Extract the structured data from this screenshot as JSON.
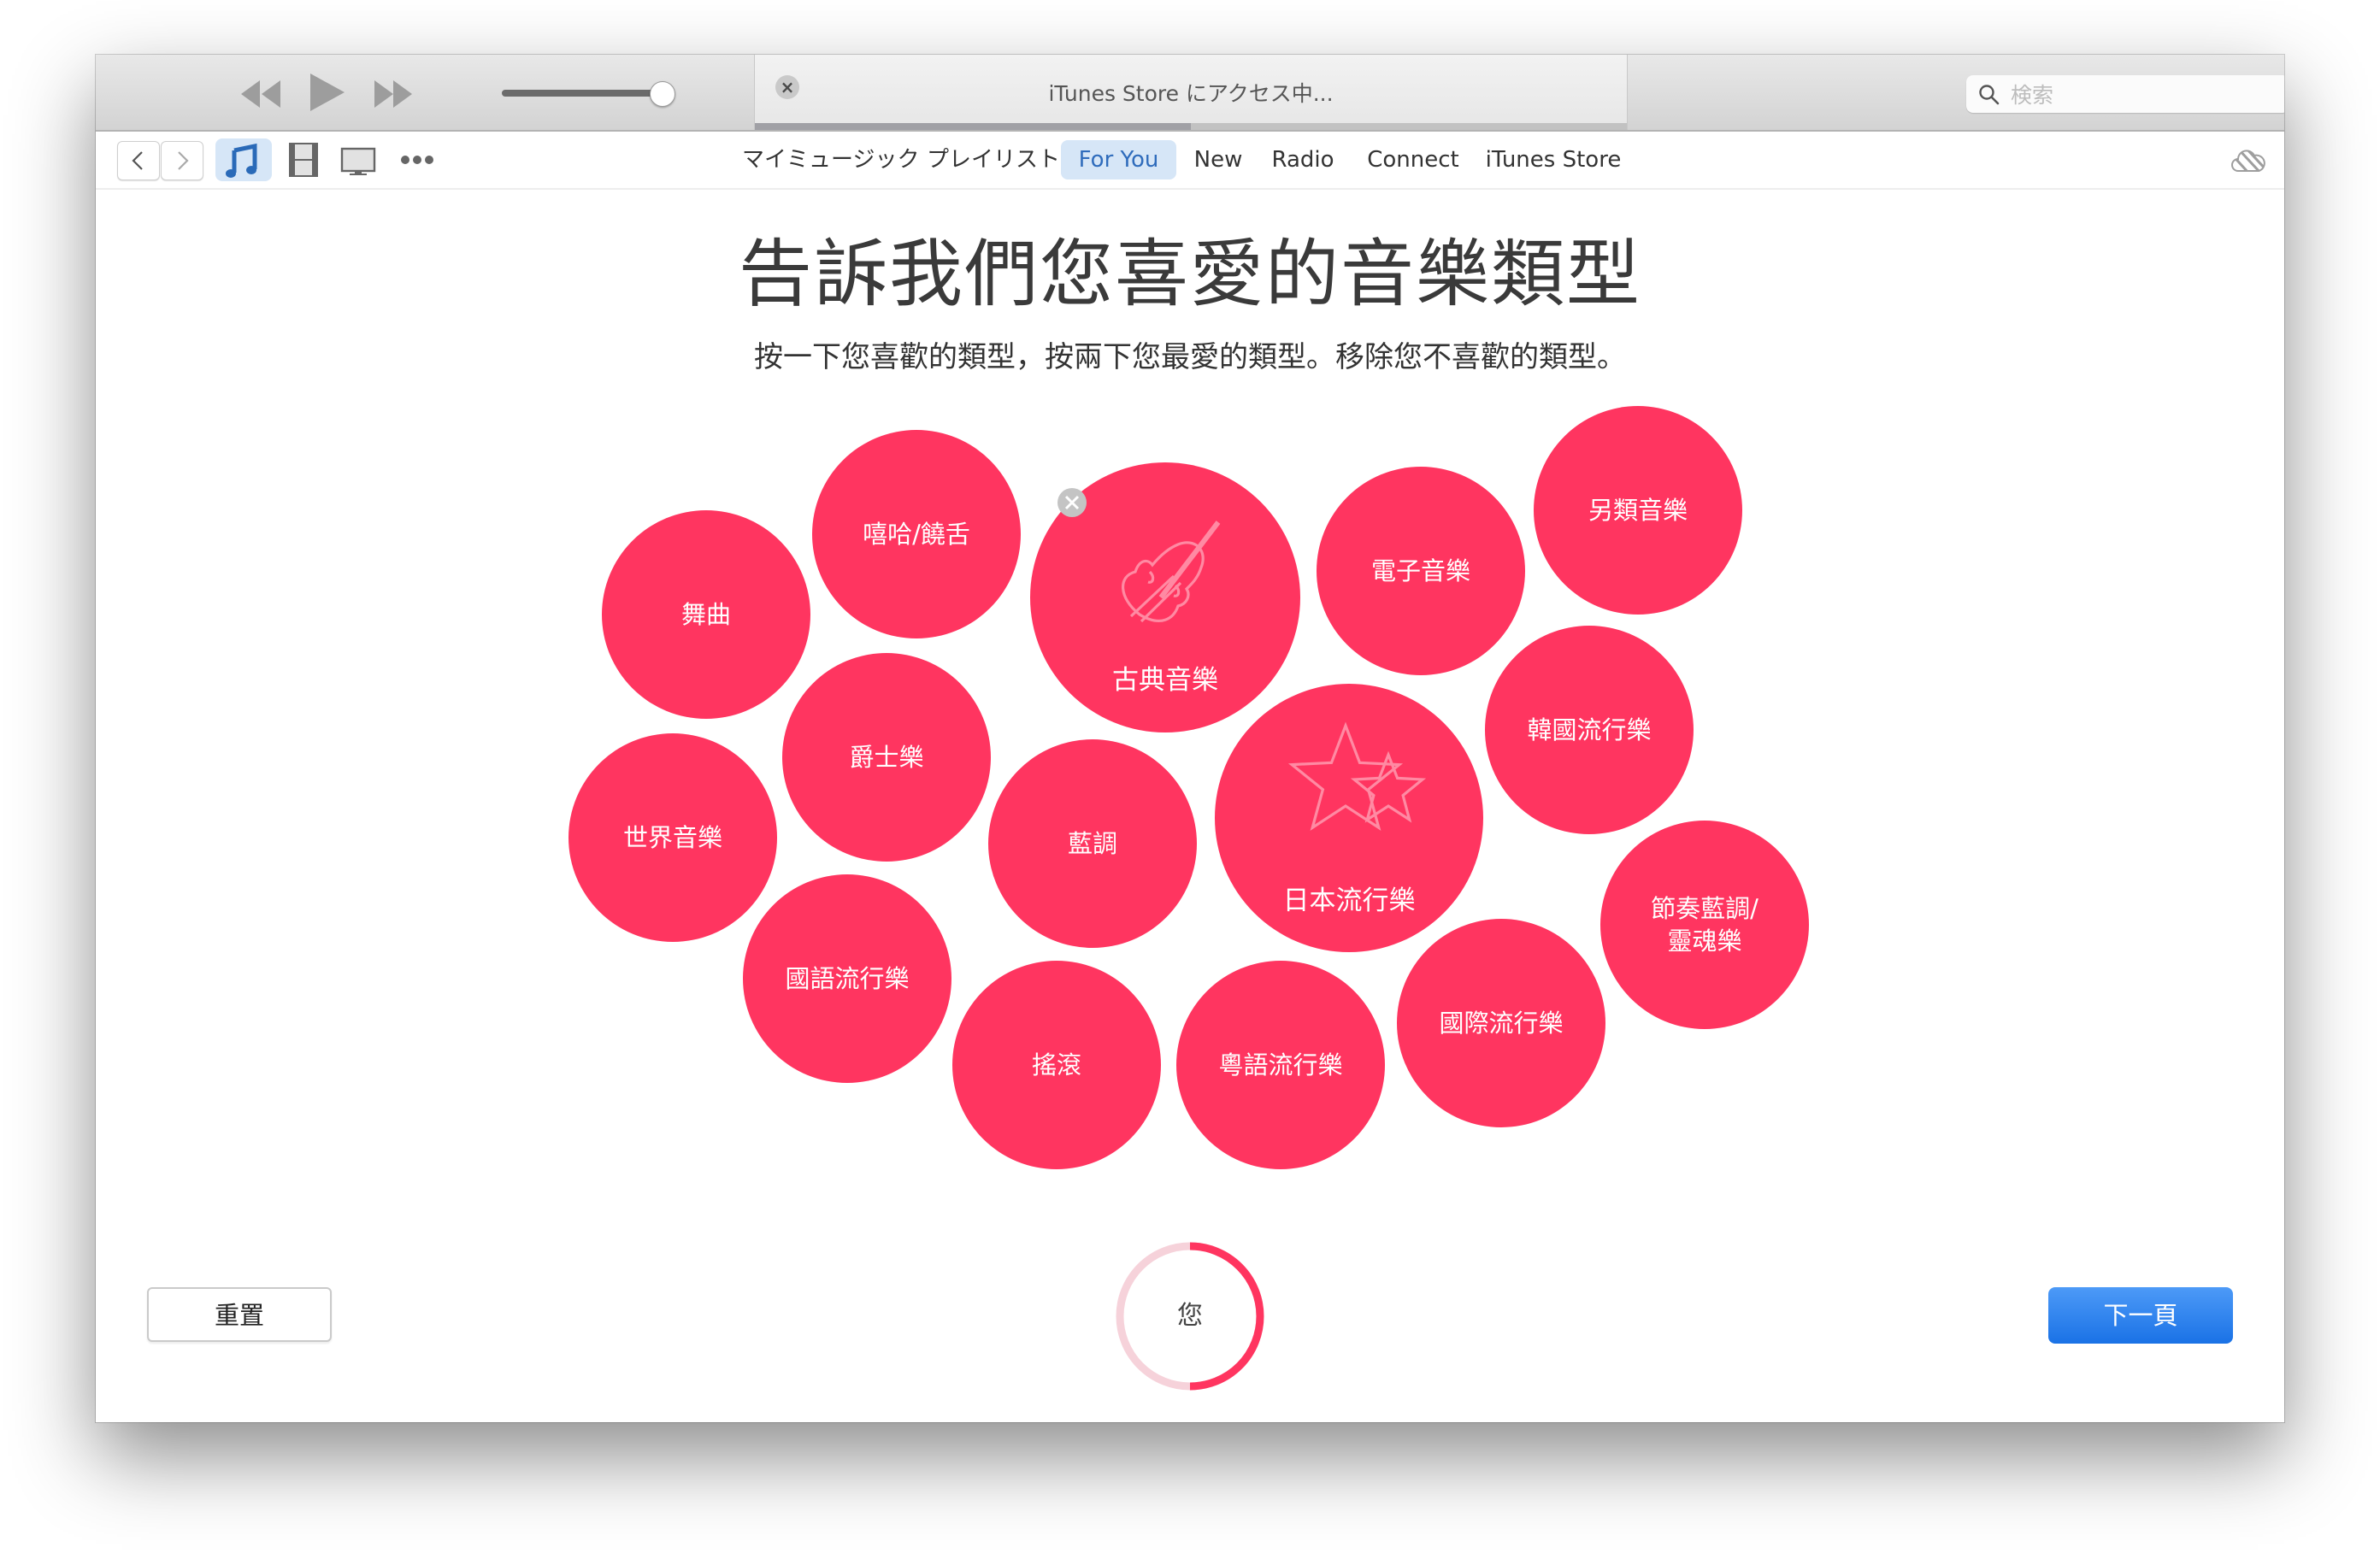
{
  "app": {
    "name": "iTunes"
  },
  "toolbar": {
    "transport": [
      {
        "id": "rewind",
        "icon": "rewind-icon"
      },
      {
        "id": "play",
        "icon": "play-icon"
      },
      {
        "id": "fast-forward",
        "icon": "fast-forward-icon"
      }
    ],
    "volume": 1.0,
    "lcd": {
      "status": "iTunes Store にアクセス中...",
      "progress": 0.5,
      "close_icon": "close-icon",
      "close_glyph": "×"
    },
    "search": {
      "placeholder": "検索",
      "value": "",
      "icon": "search-icon"
    }
  },
  "navbar": {
    "back_icon": "chevron-left-icon",
    "forward_icon": "chevron-right-icon",
    "media": [
      {
        "id": "music",
        "icon": "music-note-icon",
        "active": true
      },
      {
        "id": "movies",
        "icon": "film-icon",
        "active": false
      },
      {
        "id": "tv",
        "icon": "tv-icon",
        "active": false
      },
      {
        "id": "more",
        "icon": "more-icon",
        "active": false
      }
    ],
    "tabs": [
      {
        "label": "マイミュージック",
        "active": false
      },
      {
        "label": "プレイリスト",
        "active": false
      },
      {
        "label": "For You",
        "active": true
      },
      {
        "label": "New",
        "active": false
      },
      {
        "label": "Radio",
        "active": false
      },
      {
        "label": "Connect",
        "active": false
      },
      {
        "label": "iTunes Store",
        "active": false
      }
    ],
    "cloud_icon": "cloud-status-icon"
  },
  "main": {
    "title": "告訴我們您喜愛的音樂類型",
    "subtitle": "按一下您喜歡的類型，按兩下您最愛的類型。移除您不喜歡的類型。",
    "bubble_color": "#ff3560",
    "genres": [
      {
        "label": "舞曲",
        "favorite": false
      },
      {
        "label": "嘻哈/饒舌",
        "favorite": false
      },
      {
        "label": "古典音樂",
        "favorite": true,
        "icon": "violin-icon",
        "removable": true
      },
      {
        "label": "電子音樂",
        "favorite": false
      },
      {
        "label": "另類音樂",
        "favorite": false
      },
      {
        "label": "爵士樂",
        "favorite": false
      },
      {
        "label": "世界音樂",
        "favorite": false
      },
      {
        "label": "藍調",
        "favorite": false
      },
      {
        "label": "日本流行樂",
        "favorite": true,
        "icon": "stars-icon"
      },
      {
        "label": "韓國流行樂",
        "favorite": false
      },
      {
        "label": "節奏藍調/\n靈魂樂",
        "favorite": false
      },
      {
        "label": "國語流行樂",
        "favorite": false
      },
      {
        "label": "搖滾",
        "favorite": false
      },
      {
        "label": "粵語流行樂",
        "favorite": false
      },
      {
        "label": "國際流行樂",
        "favorite": false
      }
    ],
    "reset_label": "重置",
    "next_label": "下一頁",
    "progress": {
      "label": "您",
      "value": 0.5,
      "color": "#ff3560",
      "track_color": "#f6d2da"
    }
  }
}
